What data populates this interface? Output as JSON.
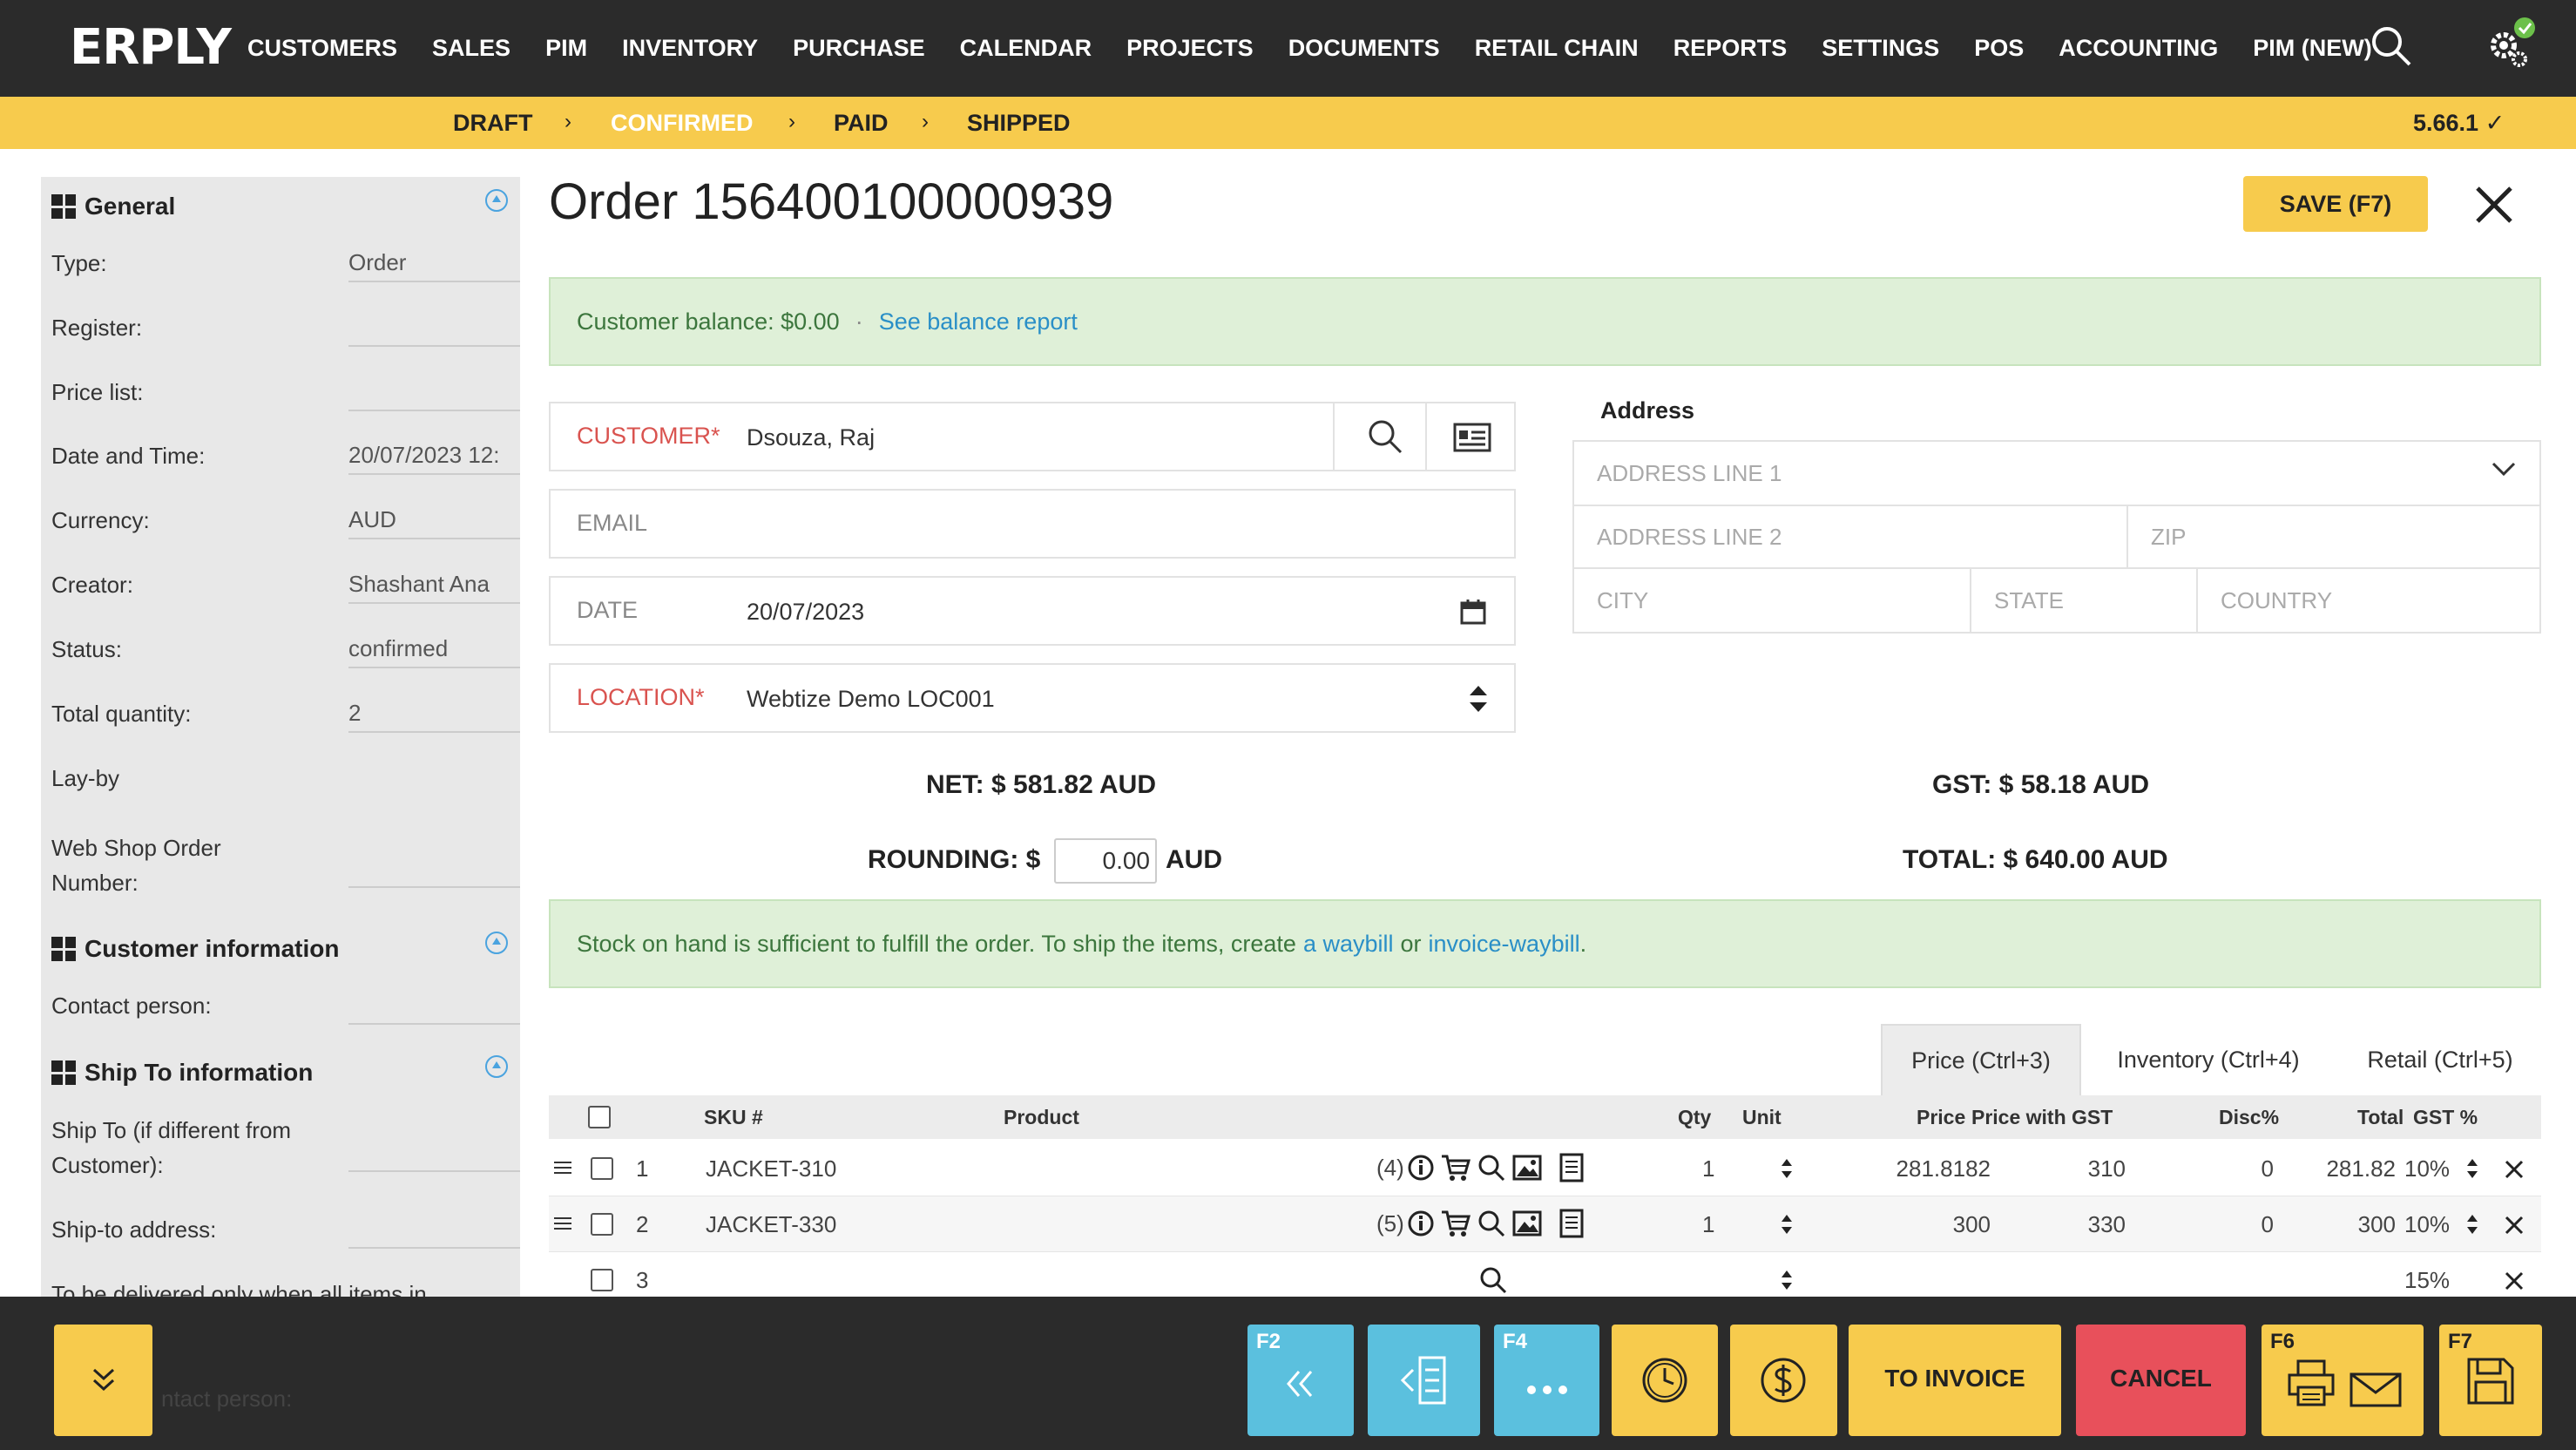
{
  "nav": {
    "logo": "ERPLY",
    "menu": [
      "CUSTOMERS",
      "SALES",
      "PIM",
      "INVENTORY",
      "PURCHASE",
      "CALENDAR",
      "PROJECTS",
      "DOCUMENTS",
      "RETAIL CHAIN",
      "REPORTS",
      "SETTINGS",
      "POS",
      "ACCOUNTING",
      "PIM (NEW)"
    ]
  },
  "status": {
    "steps": [
      "DRAFT",
      "CONFIRMED",
      "PAID",
      "SHIPPED"
    ],
    "active": "CONFIRMED",
    "separator": "›",
    "version": "5.66.1 ✓"
  },
  "sidebar": {
    "general": {
      "title": "General",
      "type_label": "Type:",
      "type_value": "Order",
      "register_label": "Register:",
      "register_value": "",
      "pricelist_label": "Price list:",
      "pricelist_value": "",
      "datetime_label": "Date and Time:",
      "datetime_value": "20/07/2023 12:",
      "currency_label": "Currency:",
      "currency_value": "AUD",
      "creator_label": "Creator:",
      "creator_value": "Shashant Ana",
      "status_label": "Status:",
      "status_value": "confirmed",
      "totalqty_label": "Total quantity:",
      "totalqty_value": "2",
      "layby_label": "Lay-by",
      "layby_checked": "✓",
      "webshop_label_1": "Web Shop Order",
      "webshop_label_2": "Number:"
    },
    "customer_info": {
      "title": "Customer information",
      "contact_label": "Contact person:"
    },
    "ship_to": {
      "title": "Ship To information",
      "shipto_label_1": "Ship To (if different from",
      "shipto_label_2": "Customer):",
      "address_label": "Ship-to address:",
      "delivered_label": "To be delivered only when all items in",
      "faded_label": "ntact person:"
    }
  },
  "order": {
    "title": "Order 156400100000939",
    "save_label": "SAVE (F7)"
  },
  "balance": {
    "text": "Customer balance: $0.00",
    "dot": "·",
    "link": "See balance report"
  },
  "form": {
    "customer_label": "CUSTOMER*",
    "customer_value": "Dsouza, Raj",
    "email_label": "EMAIL",
    "date_label": "DATE",
    "date_value": "20/07/2023",
    "location_label": "LOCATION*",
    "location_value": "Webtize Demo LOC001"
  },
  "address": {
    "title": "Address",
    "line1": "ADDRESS LINE 1",
    "line2": "ADDRESS LINE 2",
    "zip": "ZIP",
    "city": "CITY",
    "state": "STATE",
    "country": "COUNTRY"
  },
  "totals": {
    "net": "NET: $ 581.82 AUD",
    "gst": "GST: $ 58.18 AUD",
    "rounding_label": "ROUNDING: $",
    "rounding_value": "0.00",
    "rounding_unit": "AUD",
    "total": "TOTAL: $ 640.00 AUD"
  },
  "stock_notice": {
    "text": "Stock on hand is sufficient to fulfill the order. To ship the items, create",
    "link1": "a waybill",
    "or": "or",
    "link2": "invoice-waybill",
    "end": "."
  },
  "tabs": [
    "Price (Ctrl+3)",
    "Inventory (Ctrl+4)",
    "Retail (Ctrl+5)"
  ],
  "table": {
    "headers": {
      "sku": "SKU #",
      "product": "Product",
      "qty": "Qty",
      "unit": "Unit",
      "price": "Price",
      "price_gst": "Price with GST",
      "disc": "Disc%",
      "total": "Total",
      "gst": "GST %"
    },
    "rows": [
      {
        "n": "1",
        "sku": "JACKET-310",
        "stock": "(4)",
        "qty": "1",
        "price": "281.8182",
        "price_gst": "310",
        "disc": "0",
        "total": "281.82",
        "gst": "10%"
      },
      {
        "n": "2",
        "sku": "JACKET-330",
        "stock": "(5)",
        "qty": "1",
        "price": "300",
        "price_gst": "330",
        "disc": "0",
        "total": "300",
        "gst": "10%"
      },
      {
        "n": "3",
        "sku": "",
        "stock": "",
        "qty": "",
        "price": "",
        "price_gst": "",
        "disc": "",
        "total": "",
        "gst": "15%"
      }
    ]
  },
  "bottom": {
    "f2": "F2",
    "f4": "F4",
    "to_invoice": "TO INVOICE",
    "cancel": "CANCEL",
    "f6": "F6",
    "f7": "F7"
  }
}
